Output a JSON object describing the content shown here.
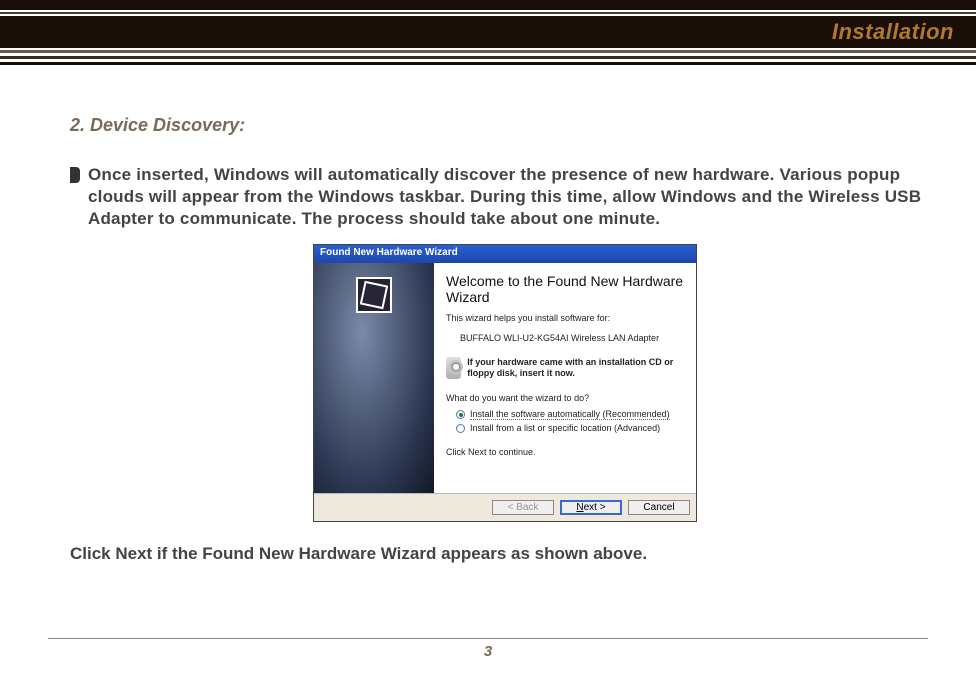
{
  "header": {
    "title": "Installation"
  },
  "section": {
    "title": "2. Device Discovery:",
    "body": "Once inserted, Windows will automatically discover the presence of new hardware. Various popup clouds will appear from the Windows taskbar. During this time, allow Windows and the Wireless USB Adapter to communicate. The process should take about one minute.",
    "closing": "Click Next if the Found New Hardware Wizard appears as shown above."
  },
  "wizard": {
    "titlebar": "Found New Hardware Wizard",
    "welcome": "Welcome to the Found New Hardware Wizard",
    "help": "This wizard helps you install software for:",
    "device": "BUFFALO WLI-U2-KG54AI   Wireless LAN Adapter",
    "cd_text": "If your hardware came with an installation CD or floppy disk, insert it now.",
    "prompt": "What do you want the wizard to do?",
    "opt_auto": "Install the software automatically (Recommended)",
    "opt_list": "Install from a list or specific location (Advanced)",
    "click_next": "Click Next to continue.",
    "btn_back": "< Back",
    "btn_next": "Next >",
    "btn_cancel": "Cancel"
  },
  "page_number": "3"
}
